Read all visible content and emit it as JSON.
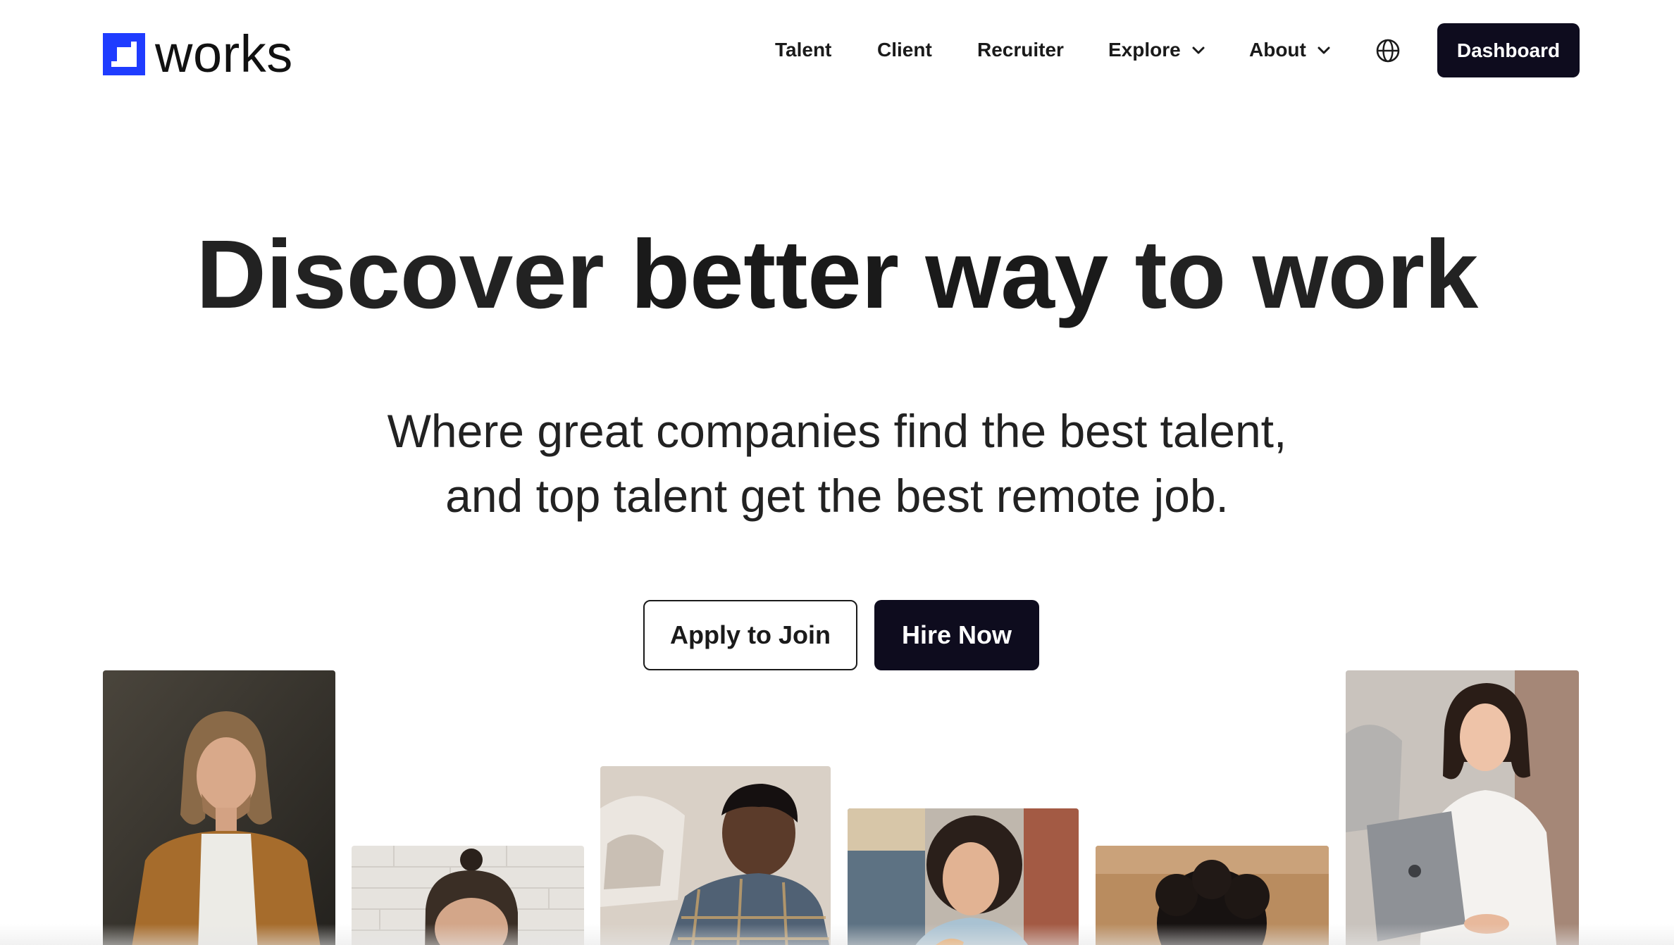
{
  "brand": {
    "name": "works",
    "accent": "#1f3cff"
  },
  "nav": {
    "items": [
      {
        "label": "Talent"
      },
      {
        "label": "Client"
      },
      {
        "label": "Recruiter"
      },
      {
        "label": "Explore",
        "dropdown": true
      },
      {
        "label": "About",
        "dropdown": true
      }
    ],
    "language_icon": "globe-icon",
    "dashboard_label": "Dashboard"
  },
  "hero": {
    "title_pre": "Discover ",
    "title_bold": "better way",
    "title_post": " to work",
    "subtitle_line1": "Where great companies find the best talent,",
    "subtitle_line2": "and top talent get the best remote job.",
    "apply_label": "Apply to Join",
    "hire_label": "Hire Now"
  },
  "colors": {
    "dark_button": "#0e0c1e",
    "text": "#1a1a1a",
    "background": "#ffffff"
  },
  "gallery": [
    {
      "subject": "man with long hair in brown jacket"
    },
    {
      "subject": "man with hair bun"
    },
    {
      "subject": "man in plaid shirt"
    },
    {
      "subject": "woman with curly hair"
    },
    {
      "subject": "person with curly afro"
    },
    {
      "subject": "woman working on laptop"
    }
  ]
}
